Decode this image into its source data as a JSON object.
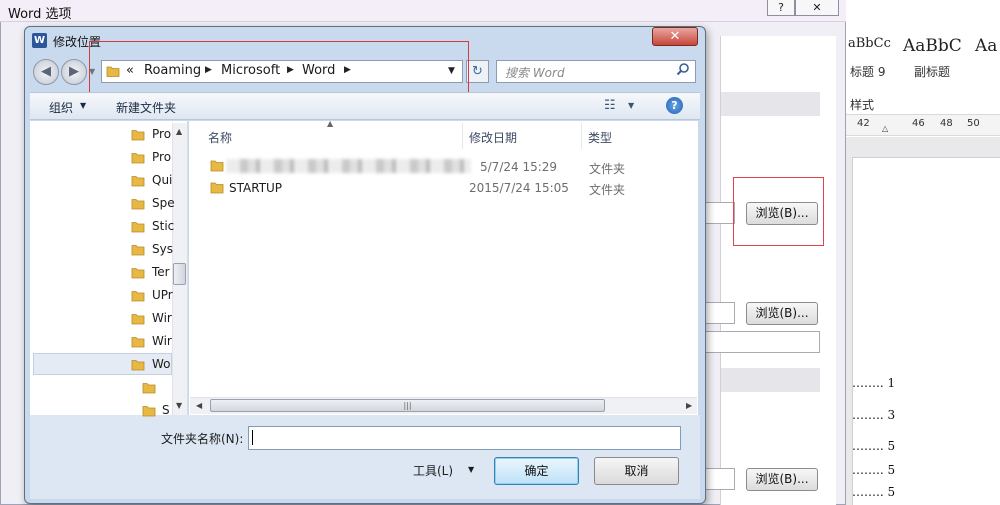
{
  "background_doc": {
    "styles": [
      {
        "preview": "aBbCc",
        "name": "标题 9"
      },
      {
        "preview": "AaBbC",
        "name": "副标题"
      },
      {
        "preview": "Aa",
        "name": ""
      }
    ],
    "group_label": "样式",
    "ruler_numbers": [
      "42",
      "46",
      "48",
      "50"
    ],
    "toc_lines": [
      "…….. 1",
      "…….. 3",
      "…….. 5",
      "…….. 5",
      "…….. 5"
    ]
  },
  "word_options": {
    "title": "Word 选项",
    "help_label": "?",
    "close_label": "✕",
    "browse_buttons": [
      "浏览(B)...",
      "浏览(B)...",
      "浏览(B)..."
    ]
  },
  "folder_dialog": {
    "title": "修改位置",
    "app_icon_letter": "W",
    "close_label": "✕",
    "breadcrumb": [
      "Roaming",
      "Microsoft",
      "Word"
    ],
    "breadcrumb_prefix": "«",
    "search_placeholder": "搜索 Word",
    "toolbar": {
      "organize": "组织",
      "new_folder": "新建文件夹"
    },
    "nav_items": [
      "Pro",
      "Pro",
      "Qui",
      "Spe",
      "Stic",
      "Sys",
      "Ter",
      "UPr",
      "Wir",
      "Wir",
      "Wo"
    ],
    "nav_sub_items": [
      "",
      "S"
    ],
    "columns": {
      "name": "名称",
      "date": "修改日期",
      "type": "类型"
    },
    "files": [
      {
        "name": "",
        "date": "5/7/24 15:29",
        "type": "文件夹"
      },
      {
        "name": "STARTUP",
        "date": "2015/7/24 15:05",
        "type": "文件夹"
      }
    ],
    "folder_name_label": "文件夹名称(N):",
    "folder_name_value": "",
    "tools_label": "工具(L)",
    "ok_label": "确定",
    "cancel_label": "取消"
  },
  "colors": {
    "accent_blue": "#2b579a",
    "highlight_red": "#d23b3b",
    "folder_yellow": "#e8b845"
  }
}
